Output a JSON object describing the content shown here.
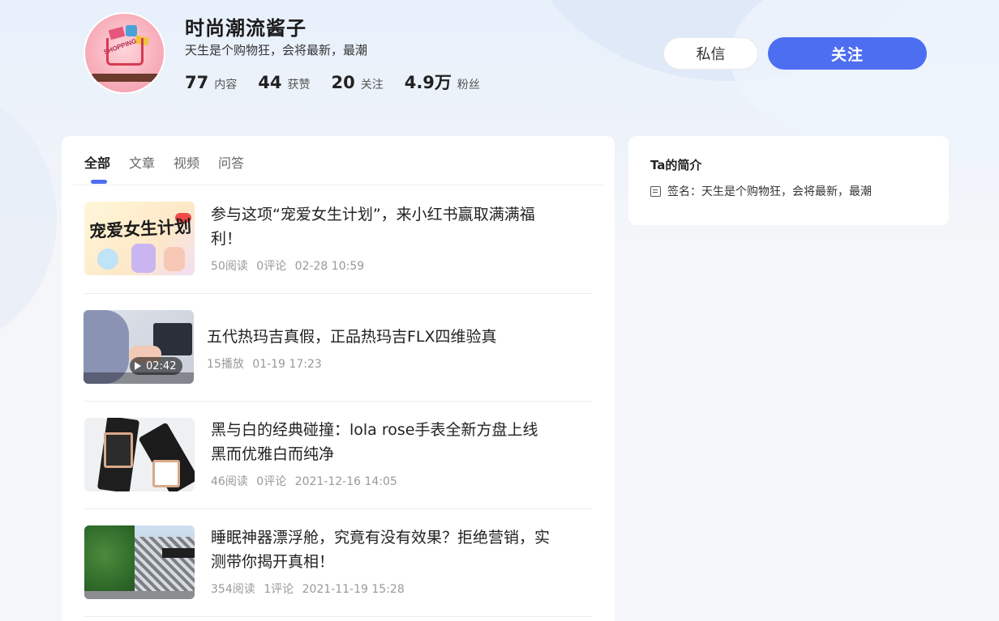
{
  "profile": {
    "name": "时尚潮流酱子",
    "bio": "天生是个购物狂，会将最新，最潮",
    "avatar_word": "SHOPPING",
    "stats": [
      {
        "num": "77",
        "label": "内容"
      },
      {
        "num": "44",
        "label": "获赞"
      },
      {
        "num": "20",
        "label": "关注"
      },
      {
        "num": "4.9万",
        "label": "粉丝"
      }
    ]
  },
  "actions": {
    "message_label": "私信",
    "follow_label": "关注"
  },
  "tabs": [
    {
      "label": "全部",
      "active": true
    },
    {
      "label": "文章",
      "active": false
    },
    {
      "label": "视频",
      "active": false
    },
    {
      "label": "问答",
      "active": false
    }
  ],
  "items": [
    {
      "title": "参与这项“宠爱女生计划”，来小红书赢取满满福利！",
      "meta": [
        "50阅读",
        "0评论",
        "02-28 10:59"
      ],
      "thumb_text": "宠爱女生计划"
    },
    {
      "title": "五代热玛吉真假，正品热玛吉FLX四维验真",
      "meta": [
        "15播放",
        "01-19 17:23"
      ],
      "duration": "02:42"
    },
    {
      "title": "黑与白的经典碰撞：lola rose手表全新方盘上线 黑而优雅白而纯净",
      "meta": [
        "46阅读",
        "0评论",
        "2021-12-16 14:05"
      ]
    },
    {
      "title": "睡眠神器漂浮舱，究竟有没有效果？拒绝营销，实测带你揭开真相！",
      "meta": [
        "354阅读",
        "1评论",
        "2021-11-19 15:28"
      ]
    }
  ],
  "intro": {
    "title": "Ta的简介",
    "signature": "签名：天生是个购物狂，会将最新，最潮"
  },
  "colors": {
    "accent": "#4e6ef2",
    "background": "#f4f6f9"
  }
}
